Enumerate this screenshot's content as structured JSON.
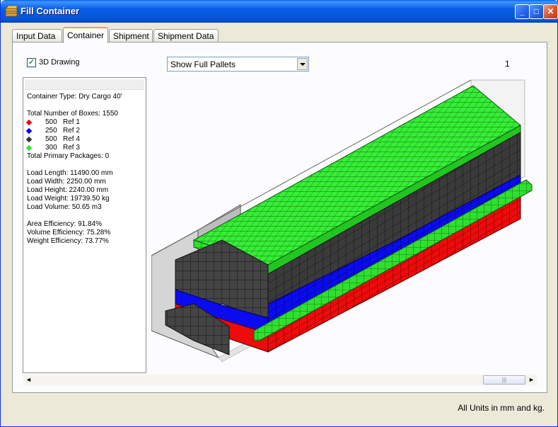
{
  "window": {
    "title": "Fill Container",
    "minimize_label": "_",
    "maximize_label": "□",
    "close_label": "✕"
  },
  "tabs": [
    {
      "label": "Input Data",
      "active": false
    },
    {
      "label": "Container",
      "active": true
    },
    {
      "label": "Shipment",
      "active": false
    },
    {
      "label": "Shipment Data",
      "active": false
    }
  ],
  "container_tab": {
    "drawing_3d": {
      "label": "3D Drawing",
      "checked": true,
      "check_glyph": "✓"
    },
    "view_select": {
      "value": "Show Full Pallets"
    },
    "page_number": "1",
    "info": {
      "container_type": "Container Type: Dry Cargo 40'",
      "total_boxes": "Total Number of Boxes: 1550",
      "refs": [
        {
          "qty": "500",
          "name": "Ref 1",
          "color": "#ff0000"
        },
        {
          "qty": "250",
          "name": "Ref 2",
          "color": "#0000ff"
        },
        {
          "qty": "500",
          "name": "Ref 4",
          "color": "#333333"
        },
        {
          "qty": "300",
          "name": "Ref 3",
          "color": "#2ee82e"
        }
      ],
      "total_primary": "Total Primary Packages: 0",
      "load_length": "Load Length: 11490.00 mm",
      "load_width": "Load Width: 2250.00 mm",
      "load_height": "Load Height: 2240.00 mm",
      "load_weight": "Load Weight: 19739.50 kg",
      "load_volume": "Load Volume: 50.65 m3",
      "area_eff": "Area Efficiency: 91.84%",
      "volume_eff": "Volume Efficiency: 75.28%",
      "weight_eff": "Weight Efficiency: 73.77%"
    },
    "scrollbar": {
      "left_arrow": "◄",
      "right_arrow": "►",
      "thumb_grip": "|||"
    }
  },
  "footer": {
    "units_note": "All Units in mm and kg."
  },
  "colors": {
    "green_box": "#33ee33",
    "dark_box": "#333333",
    "blue_box": "#0a0aee",
    "red_box": "#ee0a0a",
    "container_wall": "#d2d2d2"
  }
}
